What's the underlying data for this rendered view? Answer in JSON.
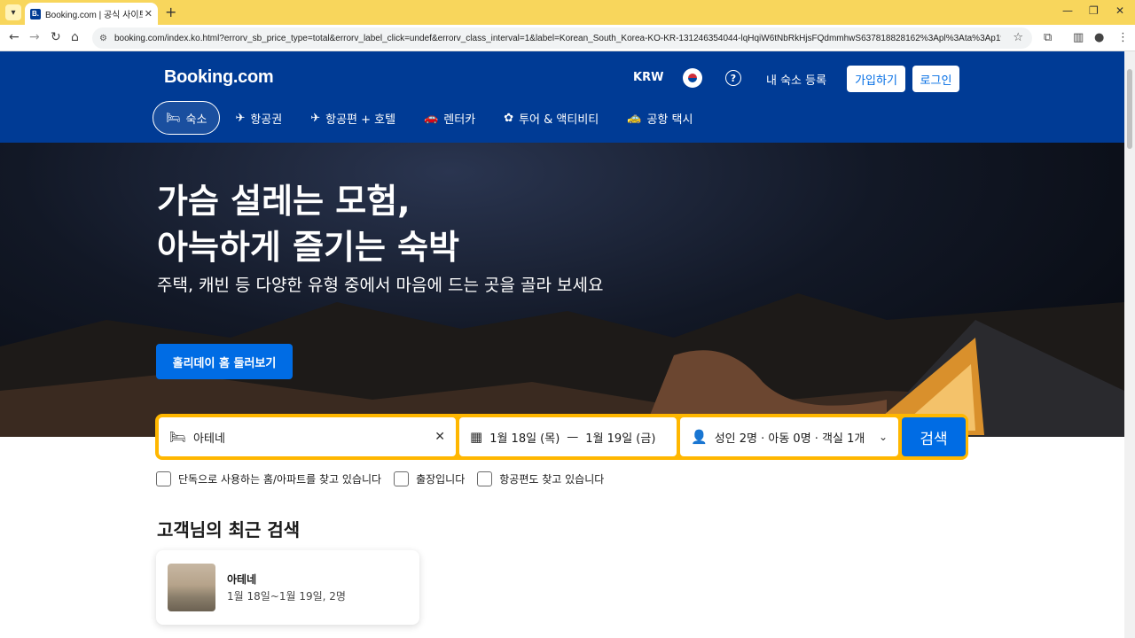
{
  "browser": {
    "tab_title": "Booking.com | 공식 사이트 | 조",
    "favicon_letter": "B.",
    "url": "booking.com/index.ko.html?errorv_sb_price_type=total&errorv_label_click=undef&errorv_class_interval=1&label=Korean_South_Korea-KO-KR-131246354044-lqHqiW6tNbRkHjsFQdmmhwS637818828162%3Apl%3Ata%3Ap1%3Ap2%3Aac..."
  },
  "header": {
    "logo": "Booking.com",
    "currency": "KRW",
    "help_symbol": "?",
    "list_property": "내 숙소 등록",
    "register": "가입하기",
    "login": "로그인"
  },
  "nav": [
    {
      "label": "숙소",
      "icon": "bed-icon",
      "glyph": "🛏"
    },
    {
      "label": "항공권",
      "icon": "plane-icon",
      "glyph": "✈"
    },
    {
      "label": "항공편 + 호텔",
      "icon": "flight-hotel-icon",
      "glyph": "✈"
    },
    {
      "label": "렌터카",
      "icon": "car-icon",
      "glyph": "🚗"
    },
    {
      "label": "투어 & 액티비티",
      "icon": "attractions-icon",
      "glyph": "✿"
    },
    {
      "label": "공항 택시",
      "icon": "taxi-icon",
      "glyph": "🚕"
    }
  ],
  "hero": {
    "title_line1": "가슴 설레는 모험,",
    "title_line2": "아늑하게 즐기는 숙박",
    "subtitle": "주택, 캐빈 등 다양한 유형 중에서 마음에 드는 곳을 골라 보세요",
    "cta": "홀리데이 홈 둘러보기"
  },
  "search": {
    "destination": "아테네",
    "dates_start": "1월 18일 (목)",
    "dates_sep": "—",
    "dates_end": "1월 19일 (금)",
    "guests": "성인 2명 · 아동 0명 · 객실 1개",
    "button": "검색"
  },
  "checkboxes": [
    {
      "label": "단독으로 사용하는 홈/아파트를 찾고 있습니다"
    },
    {
      "label": "출장입니다"
    },
    {
      "label": "항공편도 찾고 있습니다"
    }
  ],
  "recent": {
    "title": "고객님의 최근 검색",
    "items": [
      {
        "name": "아테네",
        "meta": "1월 18일~1월 19일, 2명"
      }
    ]
  }
}
